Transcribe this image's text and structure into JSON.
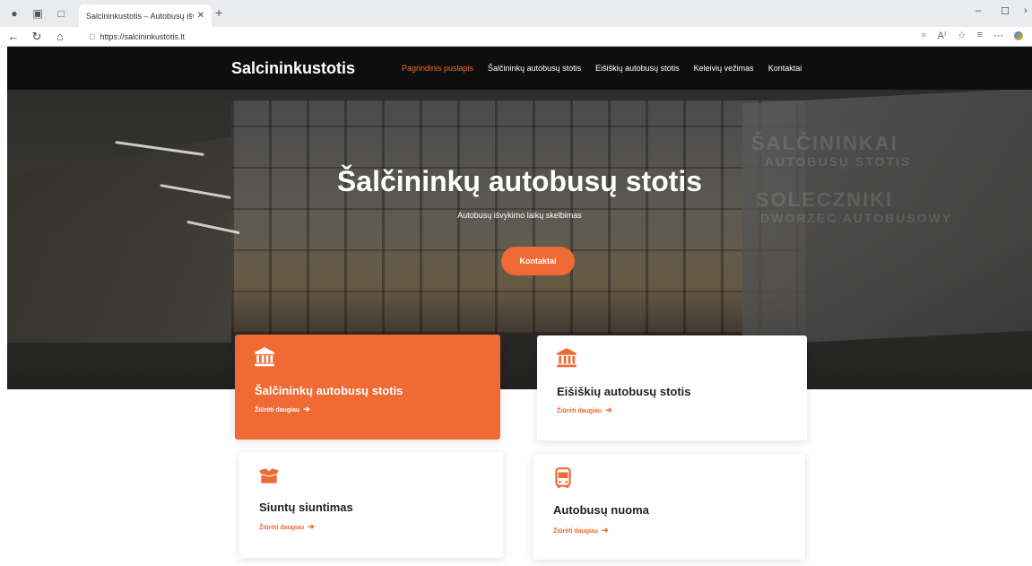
{
  "browser": {
    "tab_title": "Salcininkustotis – Autobusų išvyki",
    "tab_close": "✕",
    "new_tab": "+",
    "url": "https://salcininkustotis.lt",
    "window_minimize": "–",
    "window_maximize": "☐",
    "window_close": "›"
  },
  "nav": {
    "brand": "Salcininkustotis",
    "items": [
      {
        "label": "Pagrindinis puslapis",
        "active": true
      },
      {
        "label": "Šalčininkų autobusų stotis",
        "active": false
      },
      {
        "label": "Eišiškių autobusų stotis",
        "active": false
      },
      {
        "label": "Keleivių vežimas",
        "active": false
      },
      {
        "label": "Kontaktai",
        "active": false
      }
    ]
  },
  "hero": {
    "title": "Šalčininkų autobusų stotis",
    "subtitle": "Autobusų išvykimo laikų skelbimas",
    "button": "Kontaktai",
    "wall_text": [
      "ŠALČININKAI",
      "AUTOBUSŲ STOTIS",
      "SOLECZNIKI",
      "DWORZEC AUTOBUSOWY"
    ]
  },
  "cards": [
    {
      "title": "Šalčininkų autobusų stotis",
      "link": "Žiūrėti daugiau",
      "icon": "bank-icon",
      "highlighted": true
    },
    {
      "title": "Eišiškių autobusų stotis",
      "link": "Žiūrėti daugiau",
      "icon": "bank-icon",
      "highlighted": false
    },
    {
      "title": "Siuntų siuntimas",
      "link": "Žiūrėti daugiau",
      "icon": "box-icon",
      "highlighted": false
    },
    {
      "title": "Autobusų nuoma",
      "link": "Žiūrėti daugiau",
      "icon": "bus-icon",
      "highlighted": false
    }
  ],
  "colors": {
    "accent": "#ef6a34",
    "nav_bg": "#0a0a0a"
  }
}
